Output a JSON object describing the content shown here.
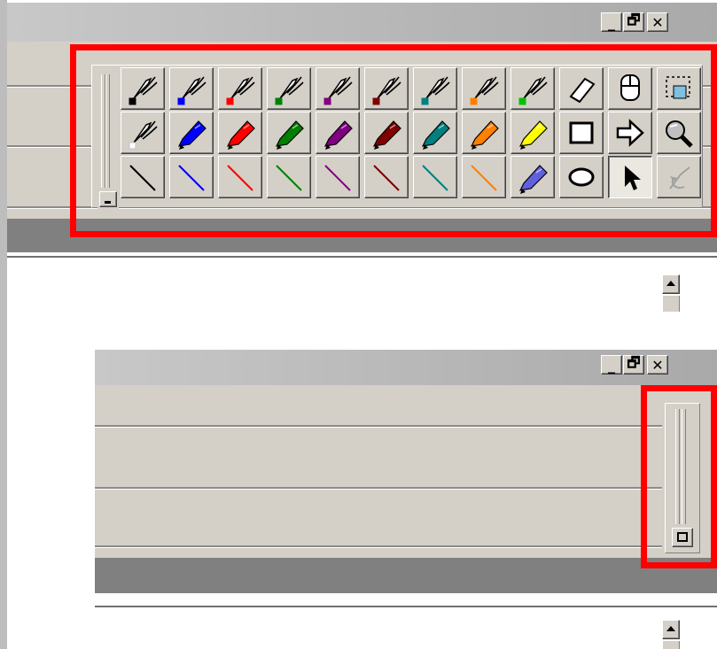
{
  "window_top": {
    "minimize": "_",
    "restore": "🗗",
    "close": "✕"
  },
  "window_bottom": {
    "minimize": "_",
    "restore": "🗗",
    "close": "✕"
  },
  "toolbar": {
    "pen_colors": [
      "#000000",
      "#0000ff",
      "#ff0000",
      "#008000",
      "#800080",
      "#800000",
      "#008080",
      "#ff8000",
      "#00c000"
    ],
    "highlighter_colors": [
      "#ffffff",
      "#0000ff",
      "#ff0000",
      "#008000",
      "#800080",
      "#800000",
      "#008080",
      "#ff8000",
      "#ffff00"
    ],
    "line_colors": [
      "#000000",
      "#0000ff",
      "#ff0000",
      "#008000",
      "#800080",
      "#800000",
      "#008080",
      "#ff8000"
    ],
    "row1_extra": [
      "eraser-icon",
      "mouse-icon",
      "select-area-icon"
    ],
    "row2_extra": [
      "rectangle-icon",
      "arrow-right-icon",
      "magnifier-icon"
    ],
    "row3_extra": [
      "blue-highlighter-icon",
      "ellipse-icon",
      "pointer-icon",
      "undo-ink-icon"
    ],
    "selected_tool": "pointer-icon"
  }
}
